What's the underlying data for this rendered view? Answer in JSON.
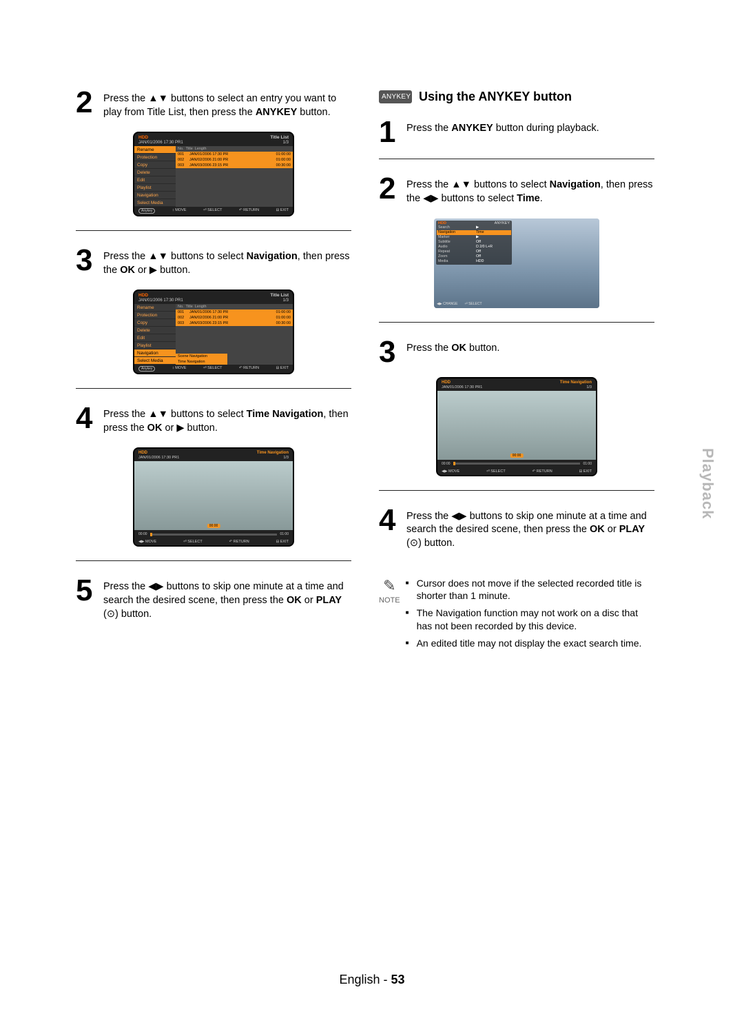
{
  "side_tab": "Playback",
  "footer": {
    "lang": "English",
    "sep": "-",
    "page": "53"
  },
  "section2": {
    "badge": "ANYKEY",
    "title": "Using the ANYKEY button"
  },
  "left": {
    "step2": {
      "num": "2",
      "t1": "Press the ",
      "t2": " buttons to select an entry you want to play from Title List, then press the ",
      "t3": "ANYKEY",
      "t4": " button."
    },
    "step3": {
      "num": "3",
      "t1": "Press the ",
      "t2": " buttons to select ",
      "t3": "Navigation",
      "t4": ", then press the ",
      "t5": "OK",
      "t6": " or ",
      "t7": " button."
    },
    "step4": {
      "num": "4",
      "t1": "Press the ",
      "t2": " buttons to select ",
      "t3": "Time Navigation",
      "t4": ", then press the ",
      "t5": "OK",
      "t6": " or ",
      "t7": " button."
    },
    "step5": {
      "num": "5",
      "t1": "Press the ",
      "t2": " buttons to skip one minute at a time and search the desired scene, then press the ",
      "t3": "OK",
      "t4": " or ",
      "t5": "PLAY",
      "t6": " (",
      "t7": ") button."
    }
  },
  "right": {
    "step1": {
      "num": "1",
      "t1": "Press the ",
      "t2": "ANYKEY",
      "t3": " button during playback."
    },
    "step2": {
      "num": "2",
      "t1": "Press the ",
      "t2": " buttons to select ",
      "t3": "Navigation",
      "t4": ", then press the ",
      "t5": " buttons to select ",
      "t6": "Time",
      "t7": "."
    },
    "step3": {
      "num": "3",
      "t1": "Press the ",
      "t2": "OK",
      "t3": " button."
    },
    "step4": {
      "num": "4",
      "t1": "Press the ",
      "t2": " buttons to skip one minute at a time and search the desired scene, then press the ",
      "t3": "OK",
      "t4": " or ",
      "t5": "PLAY",
      "t6": " (",
      "t7": ") button."
    }
  },
  "note": {
    "label": "NOTE",
    "items": [
      "Cursor does not move if the selected recorded title is shorter than 1 minute.",
      "The Navigation function may not work on a disc that has not been recorded by this device.",
      "An edited title may not display the exact search time."
    ]
  },
  "symbols": {
    "updown": "▲▼",
    "leftright": "◀▶",
    "play": "▶",
    "play_circle": "⊙"
  },
  "osd1": {
    "hdd": "HDD",
    "titlelist": "Title List",
    "sub": "JAN/01/2006 17:30 PR1",
    "idx": "1/3",
    "menu": [
      "Rename",
      "Protection",
      "Copy",
      "Delete",
      "Edit",
      "Playlist",
      "Navigation",
      "Select Media"
    ],
    "head": {
      "c1": "No.",
      "c2": "Title",
      "c3": "Length"
    },
    "rows": [
      {
        "c1": "001",
        "c2": "JAN/01/2006 17:30 PR",
        "c3": "01:00:00"
      },
      {
        "c1": "002",
        "c2": "JAN/02/2006 21:00 PR",
        "c3": "01:00:00"
      },
      {
        "c1": "003",
        "c2": "JAN/03/2006 23:15 PR",
        "c3": "00:30:00"
      }
    ],
    "foot": {
      "ak": "Anykey",
      "a": "MOVE",
      "b": "SELECT",
      "c": "RETURN",
      "d": "EXIT"
    }
  },
  "osd2": {
    "hdd": "HDD",
    "titlelist": "Title List",
    "sub": "JAN/01/2006 17:30 PR1",
    "idx": "1/3",
    "menu": [
      "Rename",
      "Protection",
      "Copy",
      "Delete",
      "Edit",
      "Playlist",
      "Navigation",
      "Select Media"
    ],
    "submenu": [
      "Scene Navigation",
      "Time Navigation"
    ],
    "head": {
      "c1": "No.",
      "c2": "Title",
      "c3": "Length"
    },
    "rows": [
      {
        "c1": "001",
        "c2": "JAN/01/2006 17:30 PR",
        "c3": "01:00:00"
      },
      {
        "c1": "002",
        "c2": "JAN/02/2006 21:00 PR",
        "c3": "01:00:00"
      },
      {
        "c1": "003",
        "c2": "JAN/03/2006 23:15 PR",
        "c3": "00:30:00"
      }
    ],
    "foot": {
      "ak": "Anykey",
      "a": "MOVE",
      "b": "SELECT",
      "c": "RETURN",
      "d": "EXIT"
    }
  },
  "osd_time": {
    "hdd": "HDD",
    "title": "Time Navigation",
    "sub": "JAN/01/2006 17:30 PR1",
    "idx": "1/3",
    "ts": "00:00",
    "left_t": "00:00",
    "right_t": "01:00",
    "foot": {
      "a": "MOVE",
      "b": "SELECT",
      "c": "RETURN",
      "d": "EXIT"
    }
  },
  "osd_play": {
    "hdd": "HDD",
    "ak": "ANYKEY",
    "rows": [
      {
        "k": "Search",
        "v": "▶"
      },
      {
        "k": "Navigation",
        "v": "Time"
      },
      {
        "k": "Marker",
        "v": "▶"
      },
      {
        "k": "Subtitle",
        "v": "Off"
      },
      {
        "k": "Audio",
        "v": "D 2/0 L+R"
      },
      {
        "k": "Repeat",
        "v": "Off"
      },
      {
        "k": "Zoom",
        "v": "Off"
      },
      {
        "k": "Media",
        "v": "HDD"
      }
    ],
    "foot": {
      "a": "CHANGE",
      "b": "SELECT"
    }
  }
}
